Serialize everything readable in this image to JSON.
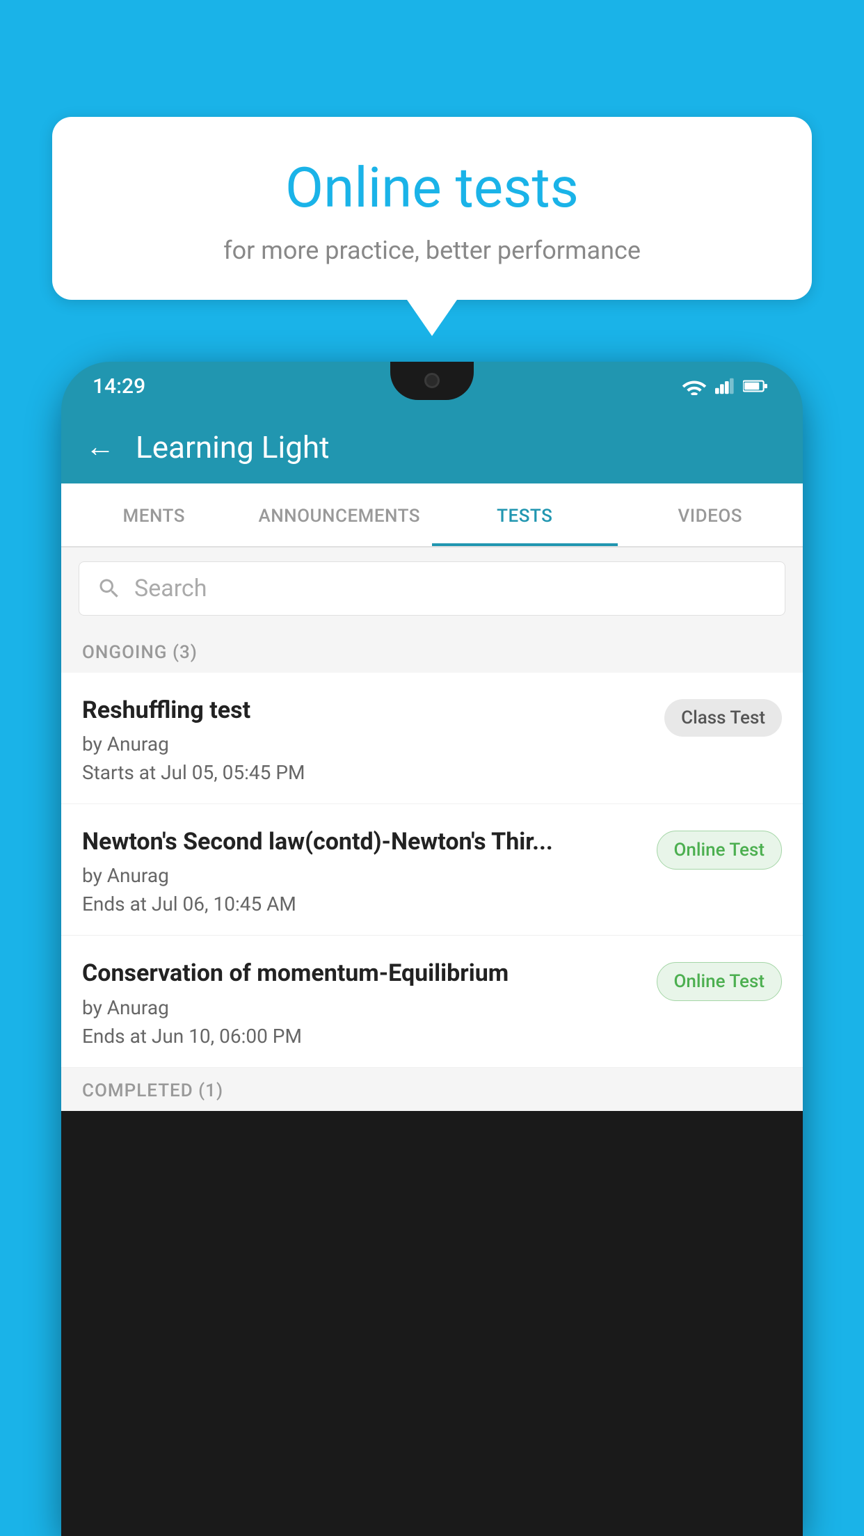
{
  "background_color": "#1ab3e8",
  "speech_bubble": {
    "title": "Online tests",
    "subtitle": "for more practice, better performance"
  },
  "phone": {
    "status_bar": {
      "time": "14:29"
    },
    "app_bar": {
      "title": "Learning Light",
      "back_label": "←"
    },
    "tabs": [
      {
        "label": "MENTS",
        "active": false
      },
      {
        "label": "ANNOUNCEMENTS",
        "active": false
      },
      {
        "label": "TESTS",
        "active": true
      },
      {
        "label": "VIDEOS",
        "active": false
      }
    ],
    "search": {
      "placeholder": "Search"
    },
    "sections": [
      {
        "header": "ONGOING (3)",
        "tests": [
          {
            "name": "Reshuffling test",
            "author": "by Anurag",
            "date": "Starts at  Jul 05, 05:45 PM",
            "badge": "Class Test",
            "badge_type": "class"
          },
          {
            "name": "Newton's Second law(contd)-Newton's Thir...",
            "author": "by Anurag",
            "date": "Ends at  Jul 06, 10:45 AM",
            "badge": "Online Test",
            "badge_type": "online"
          },
          {
            "name": "Conservation of momentum-Equilibrium",
            "author": "by Anurag",
            "date": "Ends at  Jun 10, 06:00 PM",
            "badge": "Online Test",
            "badge_type": "online"
          }
        ]
      }
    ],
    "completed_header": "COMPLETED (1)"
  }
}
